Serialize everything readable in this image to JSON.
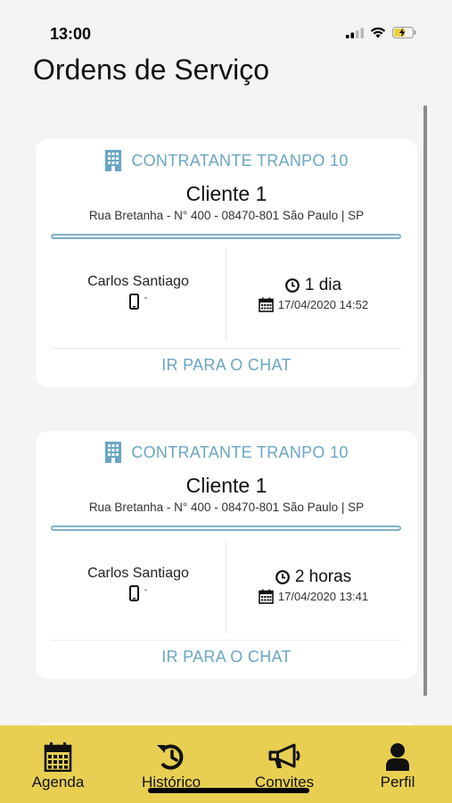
{
  "status_bar": {
    "time": "13:00",
    "signal_icon": "signal-icon",
    "wifi_icon": "wifi-icon",
    "battery_icon": "battery-charging-icon"
  },
  "page": {
    "title": "Ordens de Serviço"
  },
  "orders": [
    {
      "contractor": "CONTRATANTE TRANPO 10",
      "client": "Cliente 1",
      "address": "Rua Bretanha - N° 400 - 08470-801 São Paulo | SP",
      "provider": "Carlos Santiago",
      "phone": "-",
      "elapsed": "1 dia",
      "datetime": "17/04/2020 14:52",
      "chat_label": "IR PARA O CHAT"
    },
    {
      "contractor": "CONTRATANTE TRANPO 10",
      "client": "Cliente 1",
      "address": "Rua Bretanha - N° 400 - 08470-801 São Paulo | SP",
      "provider": "Carlos Santiago",
      "phone": "-",
      "elapsed": "2 horas",
      "datetime": "17/04/2020 13:41",
      "chat_label": "IR PARA O CHAT"
    }
  ],
  "tabs": [
    {
      "label": "Agenda",
      "icon": "calendar-icon"
    },
    {
      "label": "Histórico",
      "icon": "history-icon"
    },
    {
      "label": "Convites",
      "icon": "megaphone-icon"
    },
    {
      "label": "Perfil",
      "icon": "user-icon"
    }
  ],
  "colors": {
    "accent": "#6aa6c4",
    "tab_bar": "#e8cf52",
    "background": "#f4f4f4"
  }
}
